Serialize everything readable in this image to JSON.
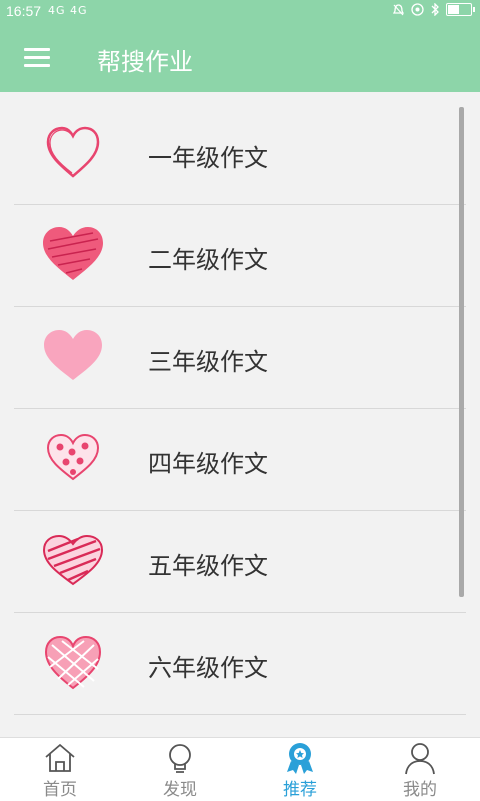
{
  "status": {
    "time": "16:57",
    "signal_text": "4G  4G",
    "battery_level": 0.5,
    "icons": [
      "alarm-icon",
      "headset-icon",
      "bluetooth-icon",
      "battery-icon"
    ]
  },
  "header": {
    "title": "帮搜作业",
    "menu_icon": "hamburger-menu-icon",
    "background": "#8dd5a9"
  },
  "list": {
    "items": [
      {
        "label": "一年级作文",
        "icon": "heart-outline-icon"
      },
      {
        "label": "二年级作文",
        "icon": "heart-scribble-icon"
      },
      {
        "label": "三年级作文",
        "icon": "heart-light-pink-icon"
      },
      {
        "label": "四年级作文",
        "icon": "heart-polka-dot-icon"
      },
      {
        "label": "五年级作文",
        "icon": "heart-striped-icon"
      },
      {
        "label": "六年级作文",
        "icon": "heart-checkered-icon"
      }
    ]
  },
  "tabs": [
    {
      "label": "首页",
      "icon": "home-icon",
      "active": false
    },
    {
      "label": "发现",
      "icon": "lightbulb-icon",
      "active": false
    },
    {
      "label": "推荐",
      "icon": "award-ribbon-icon",
      "active": true
    },
    {
      "label": "我的",
      "icon": "person-icon",
      "active": false
    }
  ],
  "colors": {
    "accent": "#8dd5a9",
    "active_tab": "#2aa0d8",
    "heart": "#e8456f"
  }
}
